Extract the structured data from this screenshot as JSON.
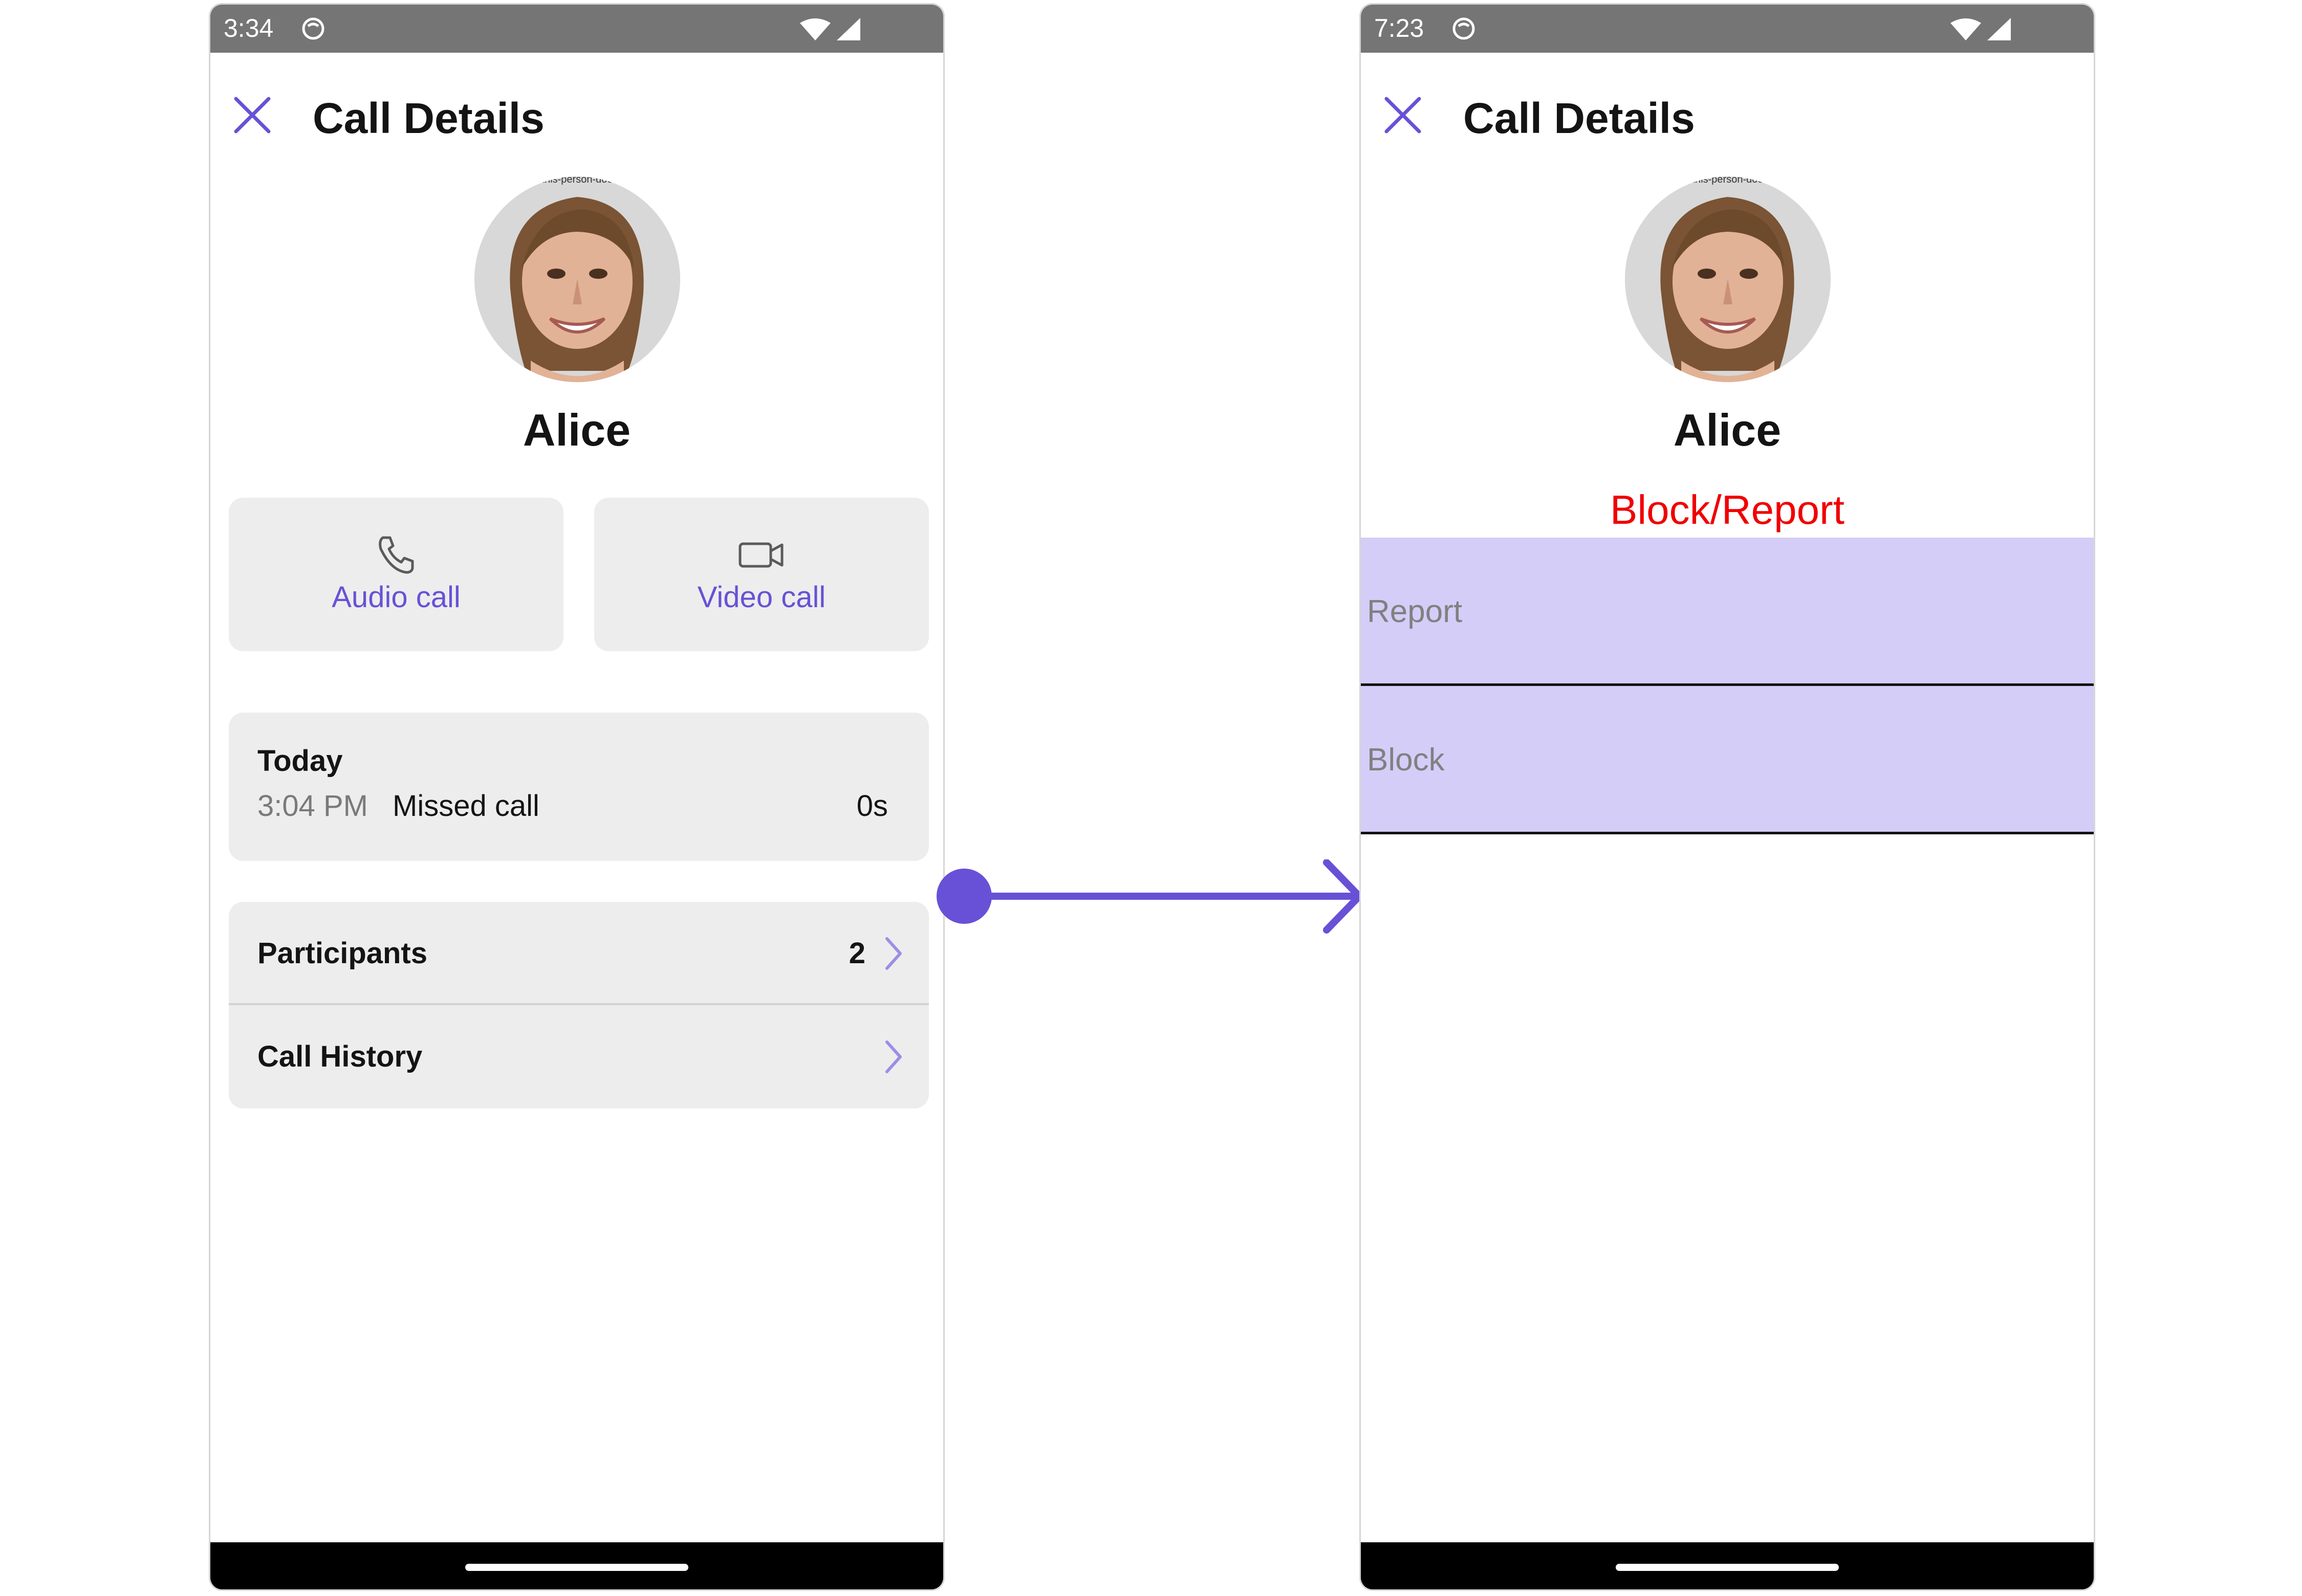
{
  "colors": {
    "accent": "#6851D6",
    "danger": "#f00000",
    "card_background": "#ededed",
    "option_background": "#d3cdf8",
    "status_bar": "#757575"
  },
  "left_screen": {
    "status_bar": {
      "time": "3:34",
      "icons": [
        "sync-icon",
        "wifi-icon",
        "signal-icon"
      ]
    },
    "header": {
      "close_icon": "close-icon",
      "title": "Call Details"
    },
    "user": {
      "name": "Alice"
    },
    "actions": [
      {
        "icon": "phone-icon",
        "label": "Audio call"
      },
      {
        "icon": "video-camera-icon",
        "label": "Video call"
      }
    ],
    "call_log": {
      "day": "Today",
      "time": "3:04 PM",
      "status": "Missed call",
      "duration": "0s"
    },
    "menu": [
      {
        "label": "Participants",
        "count": "2",
        "icon": "chevron-right-icon"
      },
      {
        "label": "Call History",
        "icon": "chevron-right-icon"
      }
    ]
  },
  "right_screen": {
    "status_bar": {
      "time": "7:23",
      "icons": [
        "sync-icon",
        "wifi-icon",
        "signal-icon"
      ]
    },
    "header": {
      "close_icon": "close-icon",
      "title": "Call Details"
    },
    "user": {
      "name": "Alice"
    },
    "section_title": "Block/Report",
    "options": [
      {
        "label": "Report"
      },
      {
        "label": "Block"
      }
    ]
  },
  "connector": {
    "icon": "arrow-right-icon"
  }
}
